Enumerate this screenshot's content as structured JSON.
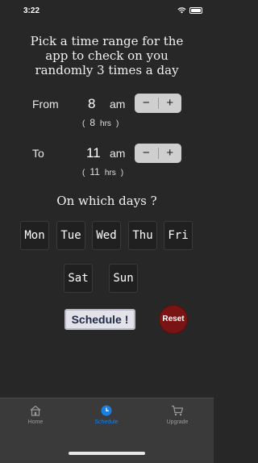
{
  "status_bar": {
    "time": "3:22"
  },
  "headline": [
    "Pick a time range for the",
    "app to check on you",
    "randomly 3 times a day"
  ],
  "from_row": {
    "label": "From",
    "hour": "8",
    "ampm": "am",
    "hrs_open": "(",
    "hrs_value": "8",
    "hrs_unit": "hrs",
    "hrs_close": ")"
  },
  "to_row": {
    "label": "To",
    "hour": "11",
    "ampm": "am",
    "hrs_open": "(",
    "hrs_value": "11",
    "hrs_unit": "hrs",
    "hrs_close": ")"
  },
  "stepper": {
    "minus": "−",
    "plus": "+"
  },
  "days_title": "On which days ?",
  "days": [
    "Mon",
    "Tue",
    "Wed",
    "Thu",
    "Fri",
    "Sat",
    "Sun"
  ],
  "buttons": {
    "schedule": "Schedule !",
    "reset": "Reset"
  },
  "tabs": [
    {
      "label": "Home",
      "icon": "home-icon"
    },
    {
      "label": "Schedule",
      "icon": "clock-icon"
    },
    {
      "label": "Upgrade",
      "icon": "cart-icon"
    }
  ],
  "colors": {
    "background": "#272727",
    "tab_active": "#1a7fe0",
    "reset": "#7a1414"
  }
}
